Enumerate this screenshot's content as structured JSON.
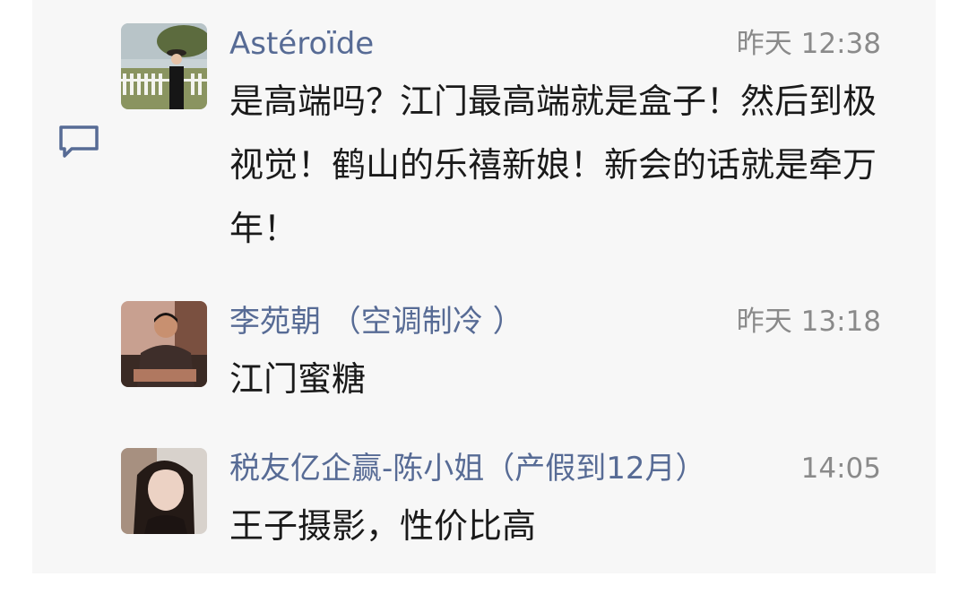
{
  "comments": [
    {
      "author": "Astéroïde",
      "time": "昨天 12:38",
      "text": "是高端吗？江门最高端就是盒子！然后到极视觉！鹤山的乐禧新娘！新会的话就是牵万年！",
      "avatar_icon": "avatar-woman-at-fence"
    },
    {
      "author": "李苑朝 （空调制冷 ）",
      "time": "昨天 13:18",
      "text": "江门蜜糖",
      "avatar_icon": "avatar-man-seated"
    },
    {
      "author": "税友亿企赢-陈小姐（产假到12月）",
      "time": "14:05",
      "text": "王子摄影，性价比高",
      "avatar_icon": "avatar-woman-portrait"
    }
  ],
  "colors": {
    "author": "#576b95",
    "time": "#8a8a8a",
    "text": "#1a1a1a",
    "panel": "#f7f7f7"
  },
  "icons": {
    "comment": "comment-bubble-icon"
  }
}
